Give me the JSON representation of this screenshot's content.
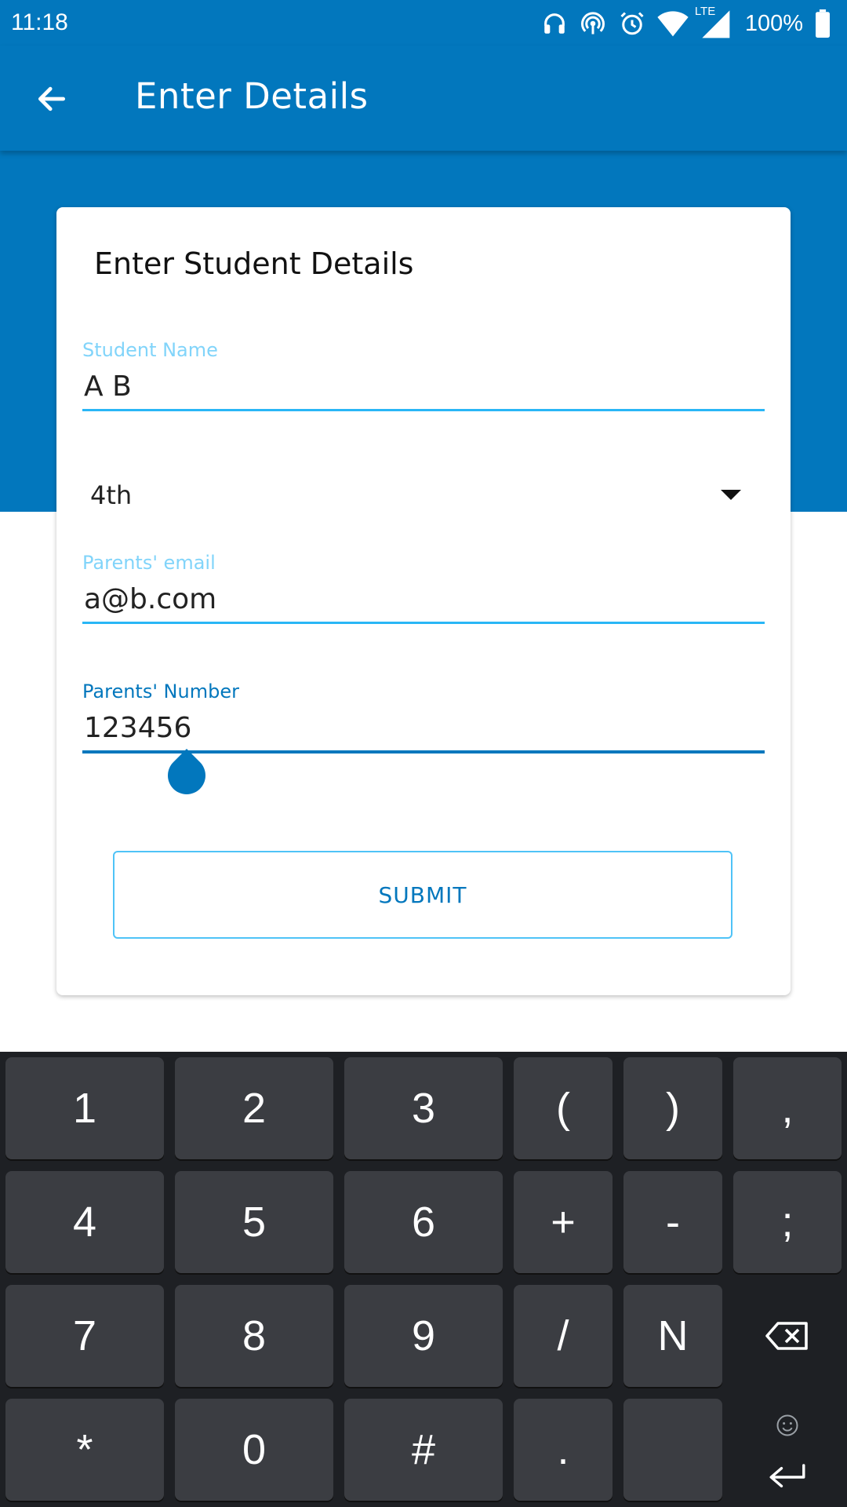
{
  "status_bar": {
    "time": "11:18",
    "network_label": "LTE",
    "battery": "100%"
  },
  "app_bar": {
    "title": "Enter Details"
  },
  "card": {
    "title": "Enter Student Details",
    "student_name": {
      "label": "Student Name",
      "value": "A B"
    },
    "grade_dropdown": {
      "value": "4th"
    },
    "parents_email": {
      "label": "Parents' email",
      "value": "a@b.com"
    },
    "parents_number": {
      "label": "Parents' Number",
      "value": "123456"
    },
    "submit_label": "SUBMIT"
  },
  "keyboard": {
    "row1": [
      "1",
      "2",
      "3",
      "(",
      ")",
      ","
    ],
    "row2": [
      "4",
      "5",
      "6",
      "+",
      "-",
      ";"
    ],
    "row3": [
      "7",
      "8",
      "9",
      "/",
      "N"
    ],
    "row4": [
      "*",
      "0",
      "#",
      ".",
      ""
    ]
  },
  "colors": {
    "primary": "#0277bd",
    "accent_light": "#29b6f6",
    "label_light": "#81d4fa",
    "keyboard_bg": "#1e2024",
    "key_bg": "#3b3d42"
  }
}
